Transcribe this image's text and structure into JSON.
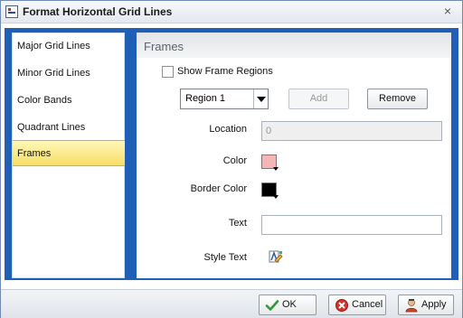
{
  "dialog": {
    "title": "Format Horizontal Grid Lines",
    "close_glyph": "×"
  },
  "nav": {
    "items": [
      {
        "label": "Major Grid Lines"
      },
      {
        "label": "Minor Grid Lines"
      },
      {
        "label": "Color Bands"
      },
      {
        "label": "Quadrant Lines"
      },
      {
        "label": "Frames"
      }
    ],
    "active": "Frames"
  },
  "panel": {
    "title": "Frames",
    "show_frame_regions": {
      "label": "Show Frame Regions",
      "checked": false
    },
    "region_select": {
      "value": "Region 1"
    },
    "add_button": "Add",
    "remove_button": "Remove",
    "location": {
      "label": "Location",
      "value": "0"
    },
    "color": {
      "label": "Color",
      "value": "#f4b6b6"
    },
    "border_color": {
      "label": "Border Color",
      "value": "#000000"
    },
    "text": {
      "label": "Text",
      "value": ""
    },
    "style_text": {
      "label": "Style Text"
    }
  },
  "footer": {
    "ok": "OK",
    "cancel": "Cancel",
    "apply": "Apply"
  },
  "icons": {
    "app": "grid-lines-app-icon",
    "close": "close-icon",
    "ok": "checkmark-icon",
    "cancel": "cancel-icon",
    "apply": "apply-icon",
    "style_text": "style-text-icon"
  }
}
